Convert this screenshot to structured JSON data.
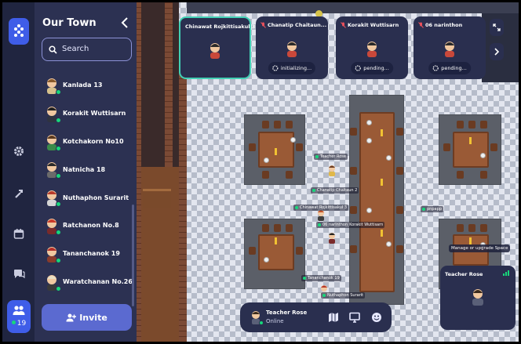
{
  "sidebar": {
    "title": "Our Town",
    "search_placeholder": "Search",
    "online_count": "19",
    "invite_label": "Invite",
    "members": [
      {
        "name": "Kanlada 13",
        "hair": "#8a5a2b",
        "shirt": "#d6c18c"
      },
      {
        "name": "Korakit Wuttisarn",
        "hair": "#222222",
        "shirt": "#2f3340"
      },
      {
        "name": "Kotchakorn No10",
        "hair": "#5b3a1f",
        "shirt": "#3b8a4a"
      },
      {
        "name": "Natnicha 18",
        "hair": "#2a2a2a",
        "shirt": "#6b6b6b"
      },
      {
        "name": "Nuthaphon Surarit",
        "hair": "#b83a2a",
        "shirt": "#d6d6d6"
      },
      {
        "name": "Ratchanon No.8",
        "hair": "#c93a2a",
        "shirt": "#7a2a2a"
      },
      {
        "name": "Tananchanok 19",
        "hair": "#b5302a",
        "shirt": "#8a3b2b"
      },
      {
        "name": "Waratchanan No.26",
        "hair": "#e9dfc4",
        "shirt": "#3a3a3a"
      }
    ]
  },
  "video_tiles": [
    {
      "name": "Chinawat Rojkittisakul 3",
      "status": "",
      "muted": false,
      "active": true
    },
    {
      "name": "Chanatip Chaitaun...",
      "status": "initializing...",
      "muted": true,
      "active": false
    },
    {
      "name": "Korakit Wuttisarn",
      "status": "pending...",
      "muted": true,
      "active": false
    },
    {
      "name": "06 narinthon",
      "status": "pending...",
      "muted": true,
      "active": false
    }
  ],
  "map_labels": [
    "Teacher Rose",
    "Chanatip Chaitaun 2",
    "Chinawat Rojkittisakul 3",
    "06 narinthon",
    "Korakit Wuttisarn",
    "pnpapp",
    "Tananchanok 19",
    "Nuthaphon Surarit"
  ],
  "tooltip": "Manage or upgrade Space",
  "self": {
    "name": "Teacher Rose",
    "status": "Online"
  },
  "colors": {
    "accent": "#3f5de8",
    "online": "#17d77b",
    "active_tile": "#42d0b5",
    "panel": "#2c3152",
    "rail": "#202540"
  }
}
